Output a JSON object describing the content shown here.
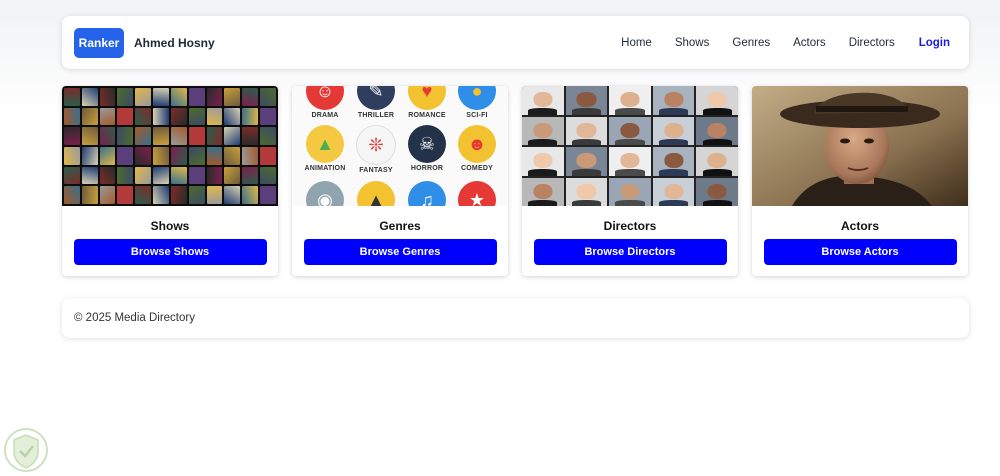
{
  "navbar": {
    "brand": "Ranker",
    "owner": "Ahmed Hosny",
    "links": [
      "Home",
      "Shows",
      "Genres",
      "Actors",
      "Directors"
    ],
    "login": "Login",
    "accent_color": "#2563eb"
  },
  "cards": [
    {
      "title": "Shows",
      "button": "Browse Shows",
      "image": "movie-posters-collage"
    },
    {
      "title": "Genres",
      "button": "Browse Genres",
      "image": "genre-icons-grid"
    },
    {
      "title": "Directors",
      "button": "Browse Directors",
      "image": "director-portraits-collage"
    },
    {
      "title": "Actors",
      "button": "Browse Actors",
      "image": "actor-portrait-photo"
    }
  ],
  "genres": [
    "DRAMA",
    "THRILLER",
    "ROMANCE",
    "SCI-FI",
    "ANIMATION",
    "FANTASY",
    "HORROR",
    "COMEDY"
  ],
  "footer": {
    "text": "© 2025 Media Directory"
  },
  "button_color": "#0000ff"
}
